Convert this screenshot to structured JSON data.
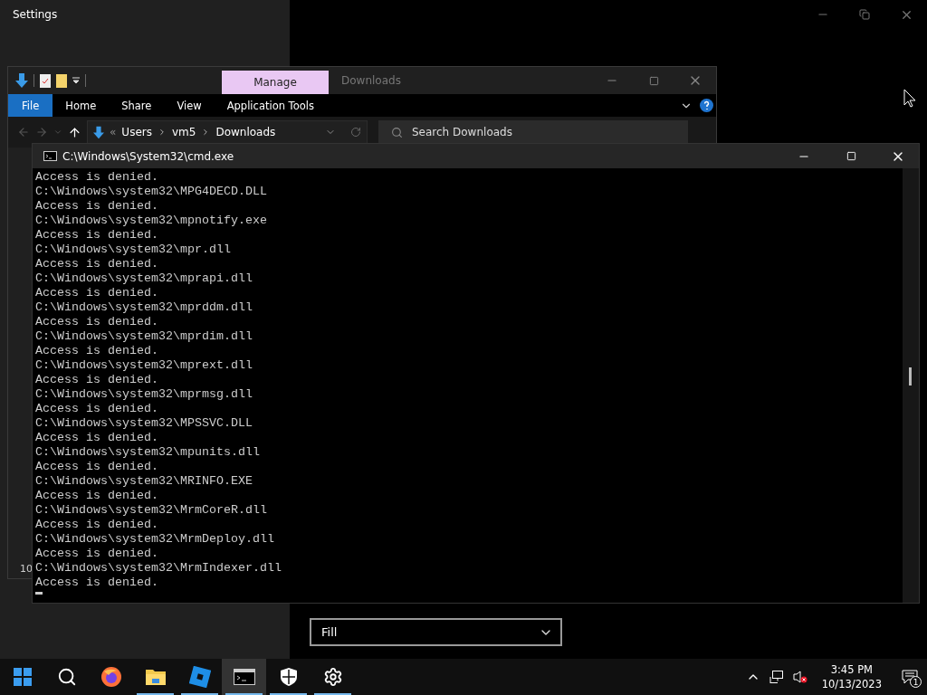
{
  "settings": {
    "title": "Settings",
    "fit_value": "Fill"
  },
  "explorer": {
    "context_tab": "Manage",
    "title": "Downloads",
    "ribbon_tabs": [
      {
        "label": "File",
        "kind": "file"
      },
      {
        "label": "Home",
        "kind": "tab"
      },
      {
        "label": "Share",
        "kind": "tab"
      },
      {
        "label": "View",
        "kind": "tab"
      },
      {
        "label": "Application Tools",
        "kind": "tab"
      }
    ],
    "path_prefix": "«",
    "breadcrumb": [
      "Users",
      "vm5",
      "Downloads"
    ],
    "search_placeholder": "Search Downloads",
    "side_number": "10"
  },
  "cmd": {
    "title": "C:\\Windows\\System32\\cmd.exe",
    "lines": [
      "Access is denied.",
      "C:\\Windows\\system32\\MPG4DECD.DLL",
      "Access is denied.",
      "C:\\Windows\\system32\\mpnotify.exe",
      "Access is denied.",
      "C:\\Windows\\system32\\mpr.dll",
      "Access is denied.",
      "C:\\Windows\\system32\\mprapi.dll",
      "Access is denied.",
      "C:\\Windows\\system32\\mprddm.dll",
      "Access is denied.",
      "C:\\Windows\\system32\\mprdim.dll",
      "Access is denied.",
      "C:\\Windows\\system32\\mprext.dll",
      "Access is denied.",
      "C:\\Windows\\system32\\mprmsg.dll",
      "Access is denied.",
      "C:\\Windows\\system32\\MPSSVC.DLL",
      "Access is denied.",
      "C:\\Windows\\system32\\mpunits.dll",
      "Access is denied.",
      "C:\\Windows\\system32\\MRINFO.EXE",
      "Access is denied.",
      "C:\\Windows\\system32\\MrmCoreR.dll",
      "Access is denied.",
      "C:\\Windows\\system32\\MrmDeploy.dll",
      "Access is denied.",
      "C:\\Windows\\system32\\MrmIndexer.dll",
      "Access is denied."
    ]
  },
  "taskbar": {
    "apps": [
      {
        "kind": "start",
        "running": false,
        "active": false
      },
      {
        "kind": "search",
        "running": false,
        "active": false
      },
      {
        "kind": "browser",
        "running": false,
        "active": false
      },
      {
        "kind": "folder",
        "running": true,
        "active": false
      },
      {
        "kind": "blocks",
        "running": true,
        "active": false
      },
      {
        "kind": "terminal",
        "running": true,
        "active": true
      },
      {
        "kind": "shield",
        "running": true,
        "active": false
      },
      {
        "kind": "gear",
        "running": true,
        "active": false
      }
    ],
    "time": "3:45 PM",
    "date": "10/13/2023",
    "notification_count": "1"
  }
}
